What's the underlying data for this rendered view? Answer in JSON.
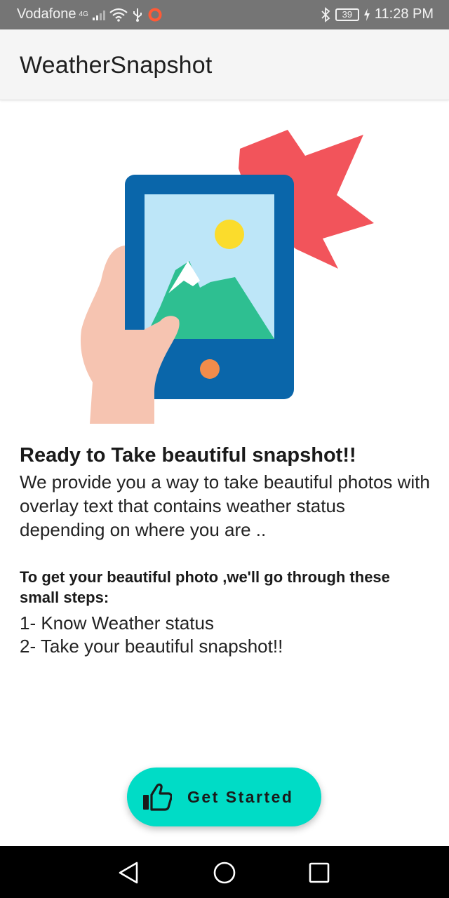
{
  "status_bar": {
    "carrier": "Vodafone",
    "network_type": "4G",
    "battery": "39",
    "time": "11:28 PM",
    "icons": [
      "signal-icon",
      "wifi-icon",
      "usb-icon",
      "notification-ring-icon",
      "bluetooth-icon",
      "battery-icon",
      "charging-icon"
    ]
  },
  "app_bar": {
    "title": "WeatherSnapshot"
  },
  "illustration": {
    "description_icon": "phone-snapshot-illustration",
    "colors": {
      "burst": "#f2545b",
      "phone_body": "#0a66aa",
      "screen_sky": "#bde6f8",
      "sun": "#fbdc2c",
      "mountain": "#2ebf91",
      "snow": "#ffffff",
      "home_button": "#f28c4b",
      "hand": "#f6c4b1"
    }
  },
  "content": {
    "headline": "Ready to Take beautiful snapshot!!",
    "description": "We provide you a way to take beautiful photos with overlay text that contains weather status depending on where you are ..",
    "steps_title": "To get your beautiful photo ,we'll go through these small steps:",
    "steps": [
      "1- Know Weather status",
      "2- Take your beautiful snapshot!!"
    ]
  },
  "button": {
    "label": "Get Started",
    "icon": "thumbs-up-icon",
    "color": "#00dcc6"
  },
  "nav_bar": {
    "buttons": [
      "back-icon",
      "home-icon",
      "recents-icon"
    ]
  }
}
